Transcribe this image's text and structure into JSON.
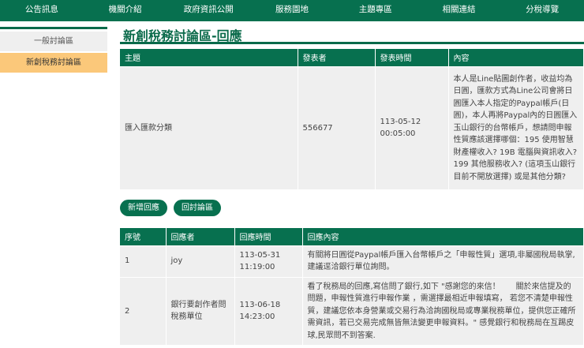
{
  "nav": [
    "公告訊息",
    "機關介紹",
    "政府資訊公開",
    "服務園地",
    "主題專區",
    "相關連結",
    "分稅導覽"
  ],
  "sidebar": [
    "一般討論區",
    "新創稅務討論區"
  ],
  "title": "新創稅務討論區-回應",
  "topic_table": {
    "headers": [
      "主題",
      "發表者",
      "發表時間",
      "內容"
    ],
    "row": {
      "subject": "匯入匯款分類",
      "author": "556677",
      "date": "113-05-12",
      "time": "00:05:00",
      "content": "本人是Line貼圖創作者，收益均為日圓，匯款方式為Line公司會將日圓匯入本人指定的Paypal帳戶(日圓)，本人再將Paypal內的日圓匯入玉山銀行的台幣帳戶，想請問申報性質應該選擇哪個：195 使用智慧財產權收入? 19B 電腦與資訊收入? 199 其他服務收入? (這項玉山銀行目前不開放選擇) 或是其他分類?"
    }
  },
  "buttons": {
    "add_reply": "新增回應",
    "back": "回討論區"
  },
  "reply_table": {
    "headers": [
      "序號",
      "回應者",
      "回應時間",
      "回應內容"
    ],
    "rows": [
      {
        "no": "1",
        "author": "joy",
        "date": "113-05-31",
        "time": "11:19:00",
        "content": "有關將日圓從Paypal帳戶匯入台幣帳戶之「申報性質」選項,非屬國稅局執掌, 建議逕洽銀行單位詢問。"
      },
      {
        "no": "2",
        "author": "銀行要創作者問稅務單位",
        "date": "113-06-18",
        "time": "14:23:00",
        "content": "看了稅務局的回應,寫信問了銀行,如下 \"感謝您的來信！　　關於來信提及的問題，申報性質進行申報作業 ，需選擇最相近申報填寫， 若您不清楚申報性質，建議您依本身營業或交易行為洽詢國稅局或專業稅務單位，提供您正確所需資訊，若已交易完成無皆無法變更申報資料。\" 感覺銀行和稅務局在互踢皮球,民眾問不到答案."
      }
    ]
  }
}
